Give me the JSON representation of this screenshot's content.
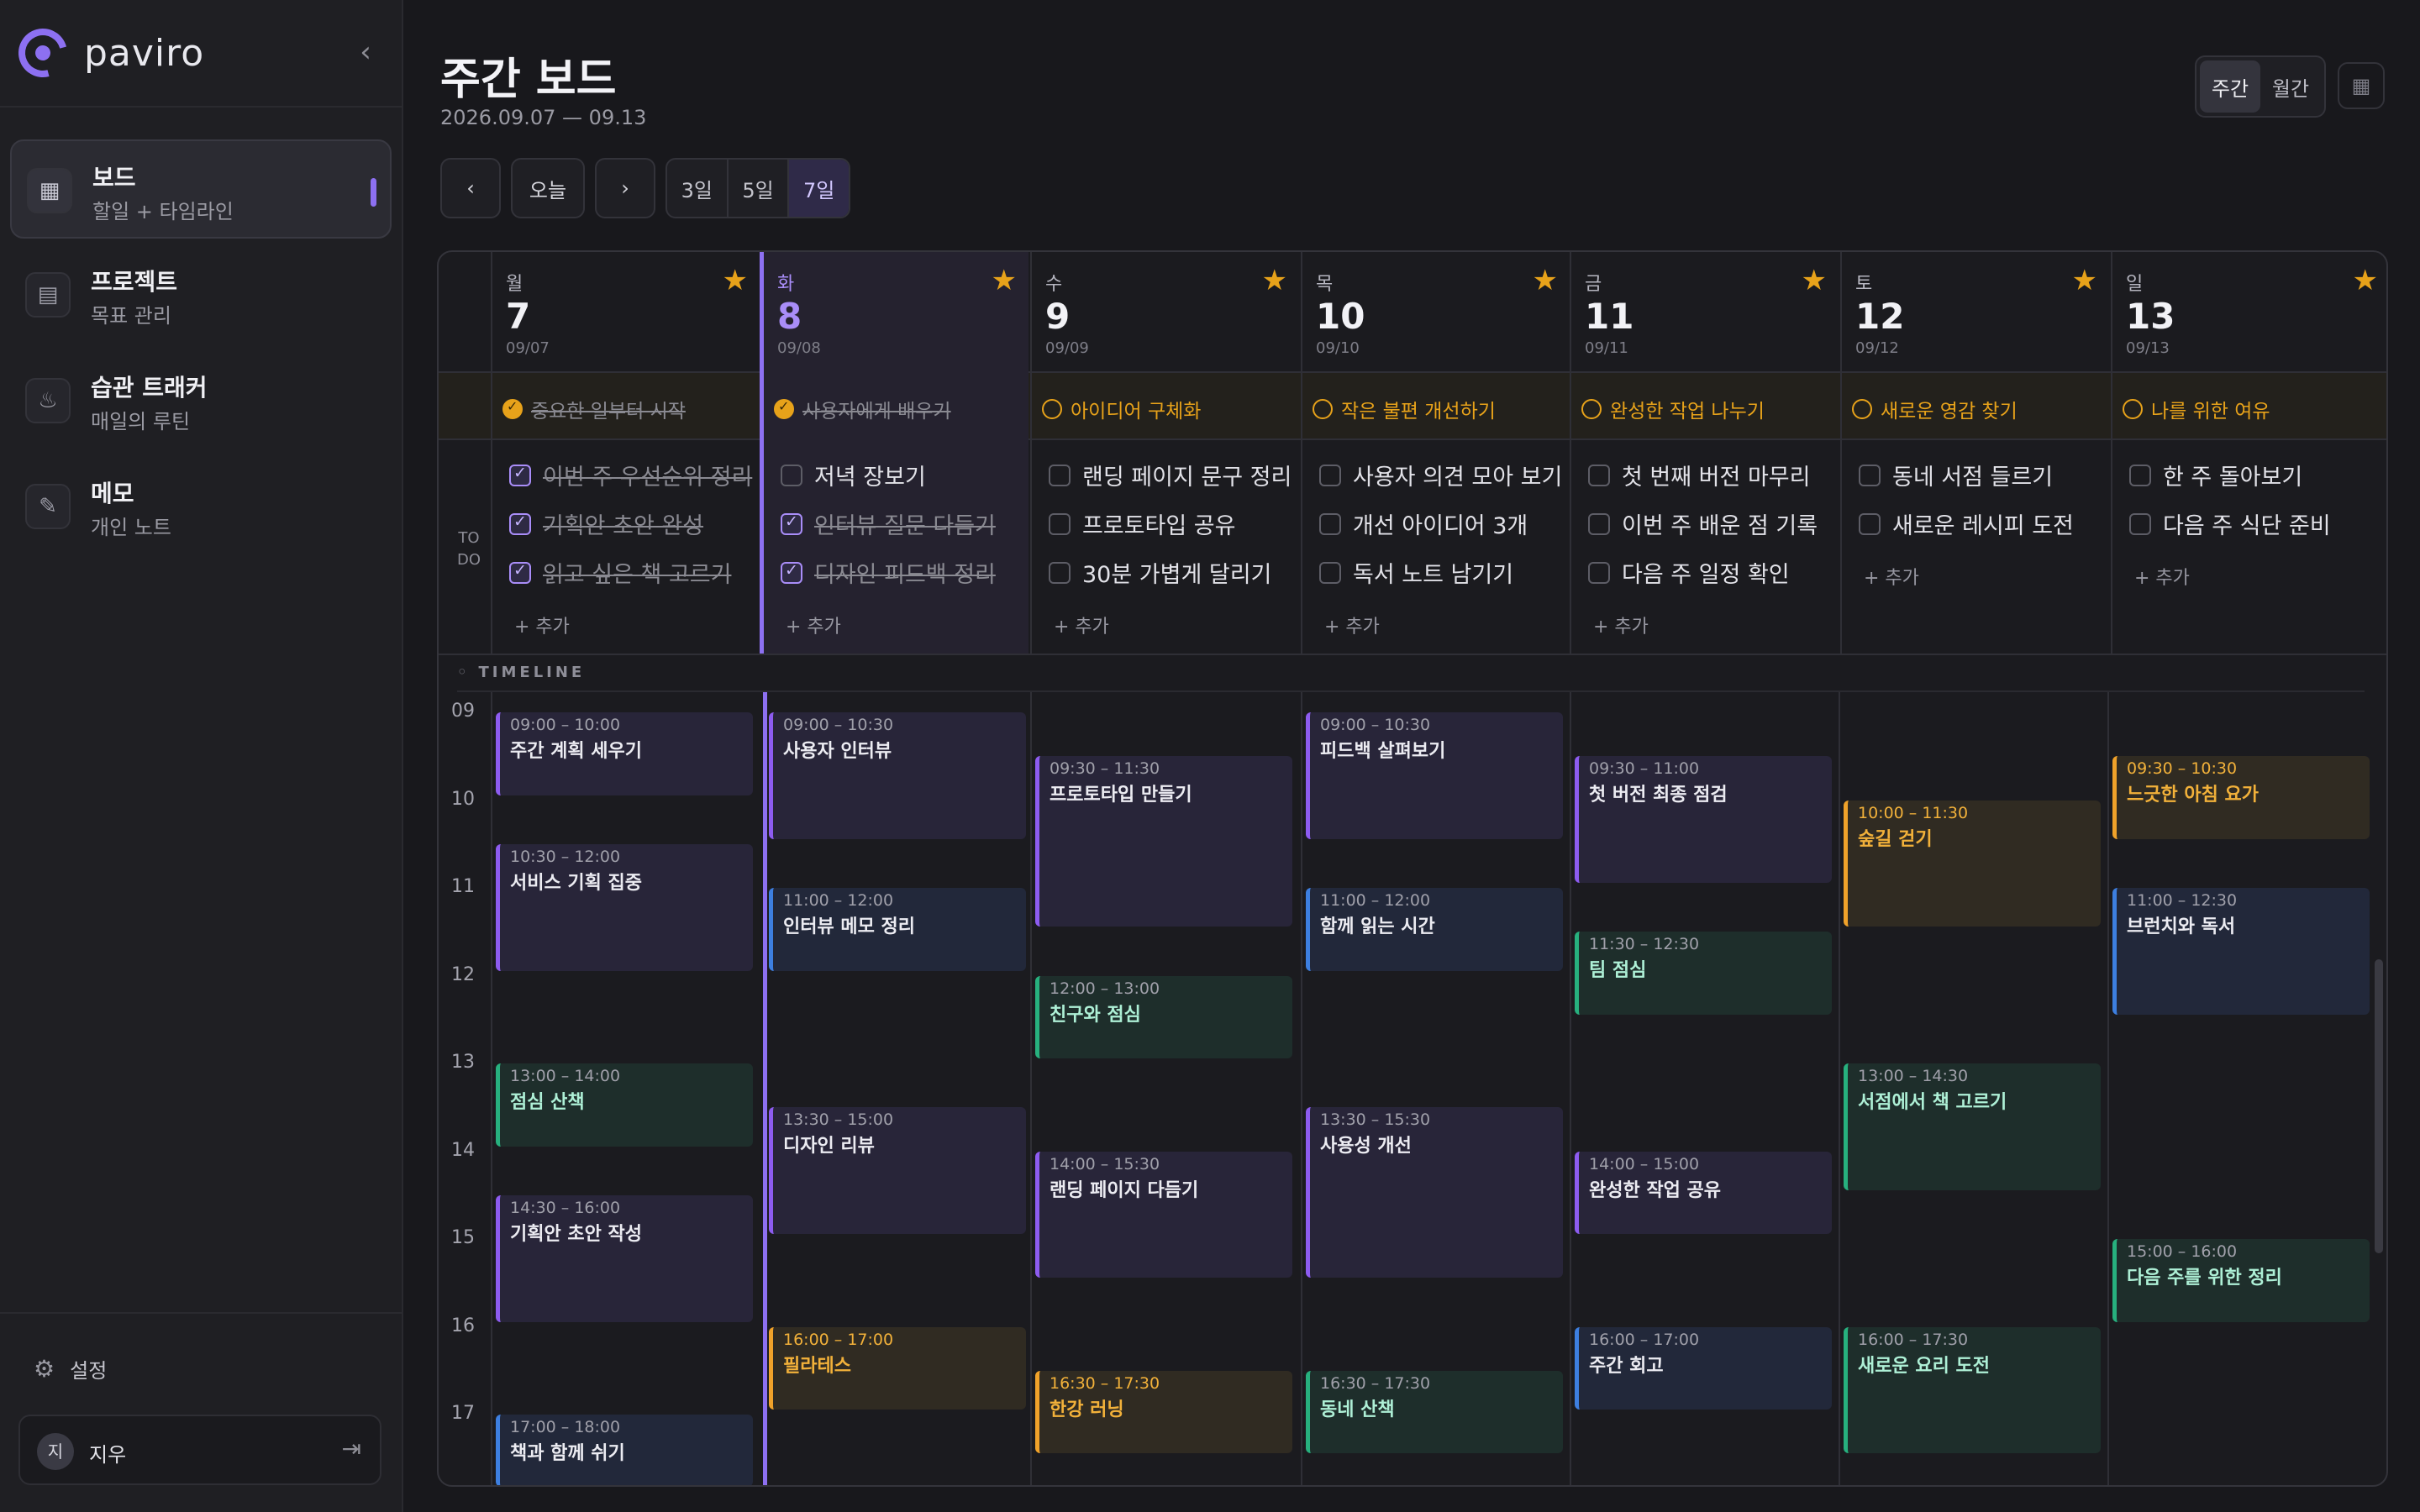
{
  "brand": {
    "name": "paviro"
  },
  "sidebar": {
    "collapse_icon": "chevron-left-icon",
    "items": [
      {
        "title": "보드",
        "sub": "할일 + 타임라인",
        "icon": "calendar-icon"
      },
      {
        "title": "프로젝트",
        "sub": "목표 관리",
        "icon": "folder-chart-icon"
      },
      {
        "title": "습관 트래커",
        "sub": "매일의 루틴",
        "icon": "flame-icon"
      },
      {
        "title": "메모",
        "sub": "개인 노트",
        "icon": "note-edit-icon"
      }
    ],
    "settings": "설정",
    "user": {
      "initial": "지",
      "name": "지우"
    }
  },
  "header": {
    "title": "주간 보드",
    "range": "2026.09.07 — 09.13",
    "today": "오늘",
    "view": [
      "주간",
      "월간"
    ],
    "span": [
      "3일",
      "5일",
      "7일"
    ]
  },
  "board": {
    "todo_label": "TO\nDO",
    "add_label": "+ 추가",
    "timeline_label": "TIMELINE",
    "hours": [
      "09",
      "10",
      "11",
      "12",
      "13",
      "14",
      "15",
      "16",
      "17"
    ],
    "days": [
      {
        "name": "월",
        "num": "7",
        "date": "09/07",
        "focus": "중요한 일부터 시작",
        "focus_done": true,
        "todos": [
          {
            "t": "이번 주 우선순위 정리",
            "d": true
          },
          {
            "t": "기획안 초안 완성",
            "d": true
          },
          {
            "t": "읽고 싶은 책 고르기",
            "d": true
          }
        ],
        "events": [
          {
            "time": "09:00 – 10:00",
            "name": "주간 계획 세우기",
            "c": "purple"
          },
          {
            "time": "10:30 – 12:00",
            "name": "서비스 기획 집중",
            "c": "purple"
          },
          {
            "time": "13:00 – 14:00",
            "name": "점심 산책",
            "c": "green"
          },
          {
            "time": "14:30 – 16:00",
            "name": "기획안 초안 작성",
            "c": "purple"
          },
          {
            "time": "17:00 – 18:00",
            "name": "책과 함께 쉬기",
            "c": "blue"
          }
        ]
      },
      {
        "name": "화",
        "num": "8",
        "date": "09/08",
        "focus": "사용자에게 배우기",
        "focus_done": true,
        "todos": [
          {
            "t": "저녁 장보기",
            "d": false
          },
          {
            "t": "인터뷰 질문 다듬기",
            "d": true
          },
          {
            "t": "디자인 피드백 정리",
            "d": true
          }
        ],
        "events": [
          {
            "time": "09:00 – 10:30",
            "name": "사용자 인터뷰",
            "c": "purple"
          },
          {
            "time": "11:00 – 12:00",
            "name": "인터뷰 메모 정리",
            "c": "blue"
          },
          {
            "time": "13:30 – 15:00",
            "name": "디자인 리뷰",
            "c": "purple"
          },
          {
            "time": "16:00 – 17:00",
            "name": "필라테스",
            "c": "orange"
          }
        ]
      },
      {
        "name": "수",
        "num": "9",
        "date": "09/09",
        "focus": "아이디어 구체화",
        "focus_done": false,
        "todos": [
          {
            "t": "랜딩 페이지 문구 정리",
            "d": false
          },
          {
            "t": "프로토타입 공유",
            "d": false
          },
          {
            "t": "30분 가볍게 달리기",
            "d": false
          }
        ],
        "events": [
          {
            "time": "09:30 – 11:30",
            "name": "프로토타입 만들기",
            "c": "purple"
          },
          {
            "time": "12:00 – 13:00",
            "name": "친구와 점심",
            "c": "green"
          },
          {
            "time": "14:00 – 15:30",
            "name": "랜딩 페이지 다듬기",
            "c": "purple"
          },
          {
            "time": "16:30 – 17:30",
            "name": "한강 러닝",
            "c": "orange"
          }
        ]
      },
      {
        "name": "목",
        "num": "10",
        "date": "09/10",
        "focus": "작은 불편 개선하기",
        "focus_done": false,
        "todos": [
          {
            "t": "사용자 의견 모아 보기",
            "d": false
          },
          {
            "t": "개선 아이디어 3개",
            "d": false
          },
          {
            "t": "독서 노트 남기기",
            "d": false
          }
        ],
        "events": [
          {
            "time": "09:00 – 10:30",
            "name": "피드백 살펴보기",
            "c": "purple"
          },
          {
            "time": "11:00 – 12:00",
            "name": "함께 읽는 시간",
            "c": "blue"
          },
          {
            "time": "13:30 – 15:30",
            "name": "사용성 개선",
            "c": "purple"
          },
          {
            "time": "16:30 – 17:30",
            "name": "동네 산책",
            "c": "green"
          }
        ]
      },
      {
        "name": "금",
        "num": "11",
        "date": "09/11",
        "focus": "완성한 작업 나누기",
        "focus_done": false,
        "todos": [
          {
            "t": "첫 번째 버전 마무리",
            "d": false
          },
          {
            "t": "이번 주 배운 점 기록",
            "d": false
          },
          {
            "t": "다음 주 일정 확인",
            "d": false
          }
        ],
        "events": [
          {
            "time": "09:30 – 11:00",
            "name": "첫 버전 최종 점검",
            "c": "purple"
          },
          {
            "time": "11:30 – 12:30",
            "name": "팀 점심",
            "c": "green"
          },
          {
            "time": "14:00 – 15:00",
            "name": "완성한 작업 공유",
            "c": "purple"
          },
          {
            "time": "16:00 – 17:00",
            "name": "주간 회고",
            "c": "blue"
          }
        ]
      },
      {
        "name": "토",
        "num": "12",
        "date": "09/12",
        "focus": "새로운 영감 찾기",
        "focus_done": false,
        "todos": [
          {
            "t": "동네 서점 들르기",
            "d": false
          },
          {
            "t": "새로운 레시피 도전",
            "d": false
          }
        ],
        "events": [
          {
            "time": "10:00 – 11:30",
            "name": "숲길 걷기",
            "c": "orange"
          },
          {
            "time": "13:00 – 14:30",
            "name": "서점에서 책 고르기",
            "c": "green"
          },
          {
            "time": "16:00 – 17:30",
            "name": "새로운 요리 도전",
            "c": "green"
          }
        ]
      },
      {
        "name": "일",
        "num": "13",
        "date": "09/13",
        "focus": "나를 위한 여유",
        "focus_done": false,
        "todos": [
          {
            "t": "한 주 돌아보기",
            "d": false
          },
          {
            "t": "다음 주 식단 준비",
            "d": false
          }
        ],
        "events": [
          {
            "time": "09:30 – 10:30",
            "name": "느긋한 아침 요가",
            "c": "orange"
          },
          {
            "time": "11:00 – 12:30",
            "name": "브런치와 독서",
            "c": "blue"
          },
          {
            "time": "15:00 – 16:00",
            "name": "다음 주를 위한 정리",
            "c": "green"
          }
        ]
      }
    ]
  }
}
